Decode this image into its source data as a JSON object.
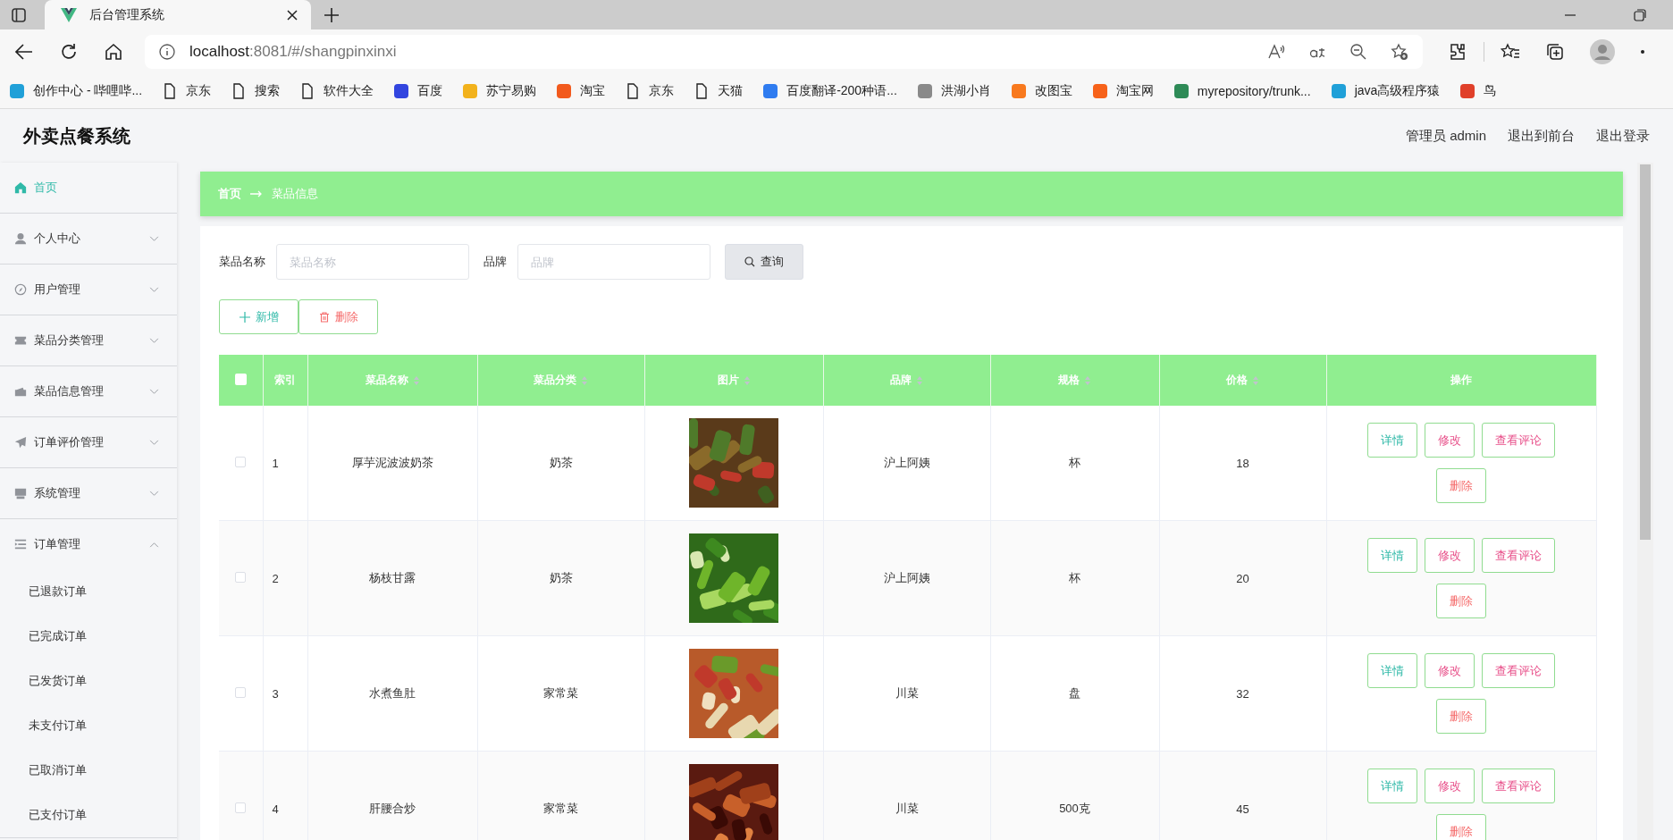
{
  "browser": {
    "tab": {
      "title": "后台管理系统"
    },
    "address": {
      "host": "localhost",
      "rest": ":8081/#/shangpinxinxi"
    },
    "bookmarks": [
      {
        "label": "创作中心 - 哔哩哔...",
        "kind": "logo",
        "color": "#20a0d8"
      },
      {
        "label": "京东",
        "kind": "page"
      },
      {
        "label": "搜索",
        "kind": "page"
      },
      {
        "label": "软件大全",
        "kind": "page"
      },
      {
        "label": "百度",
        "kind": "logo",
        "color": "#3245df"
      },
      {
        "label": "苏宁易购",
        "kind": "logo",
        "color": "#f2b21c"
      },
      {
        "label": "淘宝",
        "kind": "logo",
        "color": "#f25a1d"
      },
      {
        "label": "京东",
        "kind": "page"
      },
      {
        "label": "天猫",
        "kind": "page"
      },
      {
        "label": "百度翻译-200种语...",
        "kind": "logo",
        "color": "#2f7cf0"
      },
      {
        "label": "洪湖小肖",
        "kind": "logo",
        "color": "#8a8a8a"
      },
      {
        "label": "改图宝",
        "kind": "logo",
        "color": "#f8791e"
      },
      {
        "label": "淘宝网",
        "kind": "logo",
        "color": "#f7621a"
      },
      {
        "label": "myrepository/trunk...",
        "kind": "logo",
        "color": "#2e8b57"
      },
      {
        "label": "java高级程序猿",
        "kind": "logo",
        "color": "#20a0d8"
      },
      {
        "label": "鸟",
        "kind": "logo",
        "color": "#e0402a"
      }
    ]
  },
  "app": {
    "title": "外卖点餐系统",
    "user": "管理员 admin",
    "links": [
      "退出到前台",
      "退出登录"
    ]
  },
  "sidebar": {
    "items": [
      {
        "label": "首页",
        "selected": true,
        "expandable": false,
        "expanded": false
      },
      {
        "label": "个人中心",
        "selected": false,
        "expandable": true,
        "expanded": false
      },
      {
        "label": "用户管理",
        "selected": false,
        "expandable": true,
        "expanded": false
      },
      {
        "label": "菜品分类管理",
        "selected": false,
        "expandable": true,
        "expanded": false
      },
      {
        "label": "菜品信息管理",
        "selected": false,
        "expandable": true,
        "expanded": false
      },
      {
        "label": "订单评价管理",
        "selected": false,
        "expandable": true,
        "expanded": false
      },
      {
        "label": "系统管理",
        "selected": false,
        "expandable": true,
        "expanded": false
      },
      {
        "label": "订单管理",
        "selected": false,
        "expandable": true,
        "expanded": true,
        "children": [
          {
            "label": "已退款订单"
          },
          {
            "label": "已完成订单"
          },
          {
            "label": "已发货订单"
          },
          {
            "label": "未支付订单"
          },
          {
            "label": "已取消订单"
          },
          {
            "label": "已支付订单"
          }
        ]
      }
    ]
  },
  "breadcrumb": [
    "首页",
    "菜品信息"
  ],
  "search": {
    "fields": [
      {
        "label": "菜品名称",
        "placeholder": "菜品名称"
      },
      {
        "label": "品牌",
        "placeholder": "品牌"
      }
    ],
    "button": "查询"
  },
  "toolbar": [
    {
      "label": "新增",
      "kind": "add"
    },
    {
      "label": "删除",
      "kind": "delete"
    }
  ],
  "table": {
    "select_all": {
      "checked": false
    },
    "columns": [
      {
        "label": "索引",
        "sortable": false
      },
      {
        "label": "菜品名称",
        "sortable": true
      },
      {
        "label": "菜品分类",
        "sortable": true
      },
      {
        "label": "图片",
        "sortable": true
      },
      {
        "label": "品牌",
        "sortable": true
      },
      {
        "label": "规格",
        "sortable": true
      },
      {
        "label": "价格",
        "sortable": true
      },
      {
        "label": "操作",
        "sortable": false
      }
    ],
    "rows": [
      {
        "checked": false,
        "index": "1",
        "name": "厚芋泥波波奶茶",
        "category": "奶茶",
        "brand": "沪上阿姨",
        "spec": "杯",
        "price": "18",
        "actions": [
          {
            "label": "详情",
            "kind": "info"
          },
          {
            "label": "修改",
            "kind": "edit"
          },
          {
            "label": "查看评论",
            "kind": "edit"
          },
          {
            "label": "删除",
            "kind": "delete"
          }
        ]
      },
      {
        "checked": false,
        "index": "2",
        "name": "杨枝甘露",
        "category": "奶茶",
        "brand": "沪上阿姨",
        "spec": "杯",
        "price": "20",
        "actions": [
          {
            "label": "详情",
            "kind": "info"
          },
          {
            "label": "修改",
            "kind": "edit"
          },
          {
            "label": "查看评论",
            "kind": "edit"
          },
          {
            "label": "删除",
            "kind": "delete"
          }
        ]
      },
      {
        "checked": false,
        "index": "3",
        "name": "水煮鱼肚",
        "category": "家常菜",
        "brand": "川菜",
        "spec": "盘",
        "price": "32",
        "actions": [
          {
            "label": "详情",
            "kind": "info"
          },
          {
            "label": "修改",
            "kind": "edit"
          },
          {
            "label": "查看评论",
            "kind": "edit"
          },
          {
            "label": "删除",
            "kind": "delete"
          }
        ]
      },
      {
        "checked": false,
        "index": "4",
        "name": "肝腰合炒",
        "category": "家常菜",
        "brand": "川菜",
        "spec": "500克",
        "price": "45",
        "actions": [
          {
            "label": "详情",
            "kind": "info"
          },
          {
            "label": "修改",
            "kind": "edit"
          },
          {
            "label": "查看评论",
            "kind": "edit"
          },
          {
            "label": "删除",
            "kind": "delete"
          }
        ]
      }
    ]
  }
}
